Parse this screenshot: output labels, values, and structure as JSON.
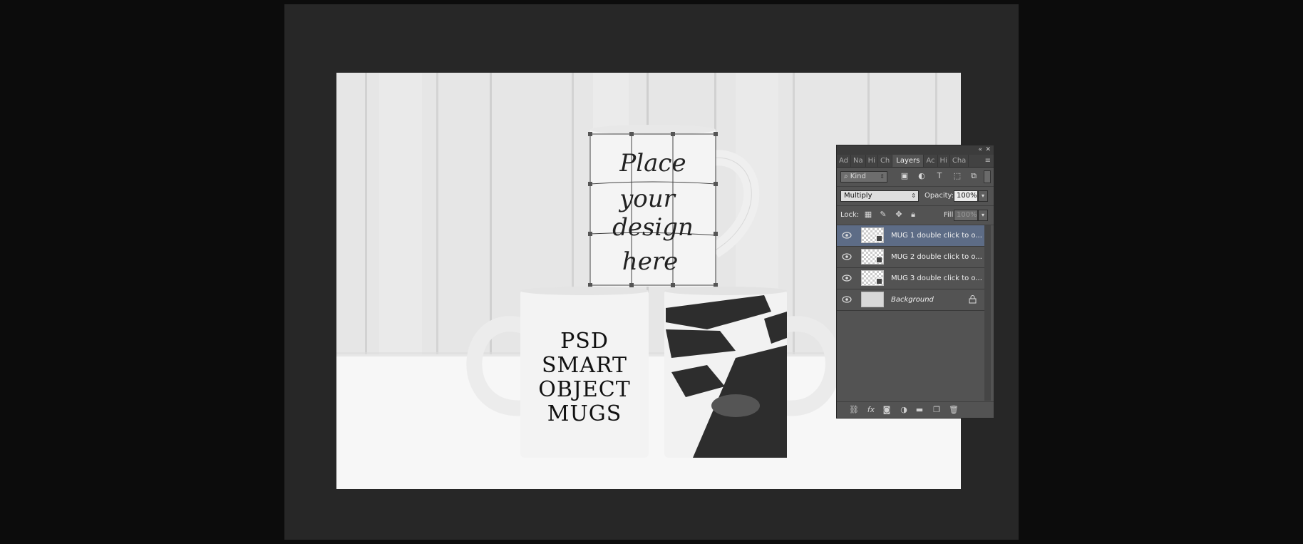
{
  "photo": {
    "mug_top_text": [
      "Place",
      "your",
      "design",
      "here"
    ],
    "mug_left_text": [
      "PSD",
      "SMART",
      "OBJECT",
      "MUGS"
    ]
  },
  "layers_panel": {
    "tabs": [
      {
        "label": "Ad",
        "active": false
      },
      {
        "label": "Na",
        "active": false
      },
      {
        "label": "Hi",
        "active": false
      },
      {
        "label": "Ch",
        "active": false
      },
      {
        "label": "Layers",
        "active": true
      },
      {
        "label": "Ac",
        "active": false
      },
      {
        "label": "Hi",
        "active": false
      },
      {
        "label": "Cha",
        "active": false
      }
    ],
    "filter_kind": "Kind",
    "blend_mode": "Multiply",
    "opacity_label": "Opacity:",
    "opacity_value": "100%",
    "lock_label": "Lock:",
    "fill_label": "Fill:",
    "fill_value": "100%",
    "layers": [
      {
        "name": "MUG 1 double click to o...",
        "selected": true
      },
      {
        "name": "MUG 2 double click to o...",
        "selected": false
      },
      {
        "name": "MUG 3 double click to o...",
        "selected": false
      },
      {
        "name": "Background",
        "selected": false
      }
    ],
    "icons": {
      "collapse": "«",
      "close": "✕",
      "menu": "≡",
      "link": "⛓",
      "fx": "fx",
      "trash": "🗑"
    }
  }
}
